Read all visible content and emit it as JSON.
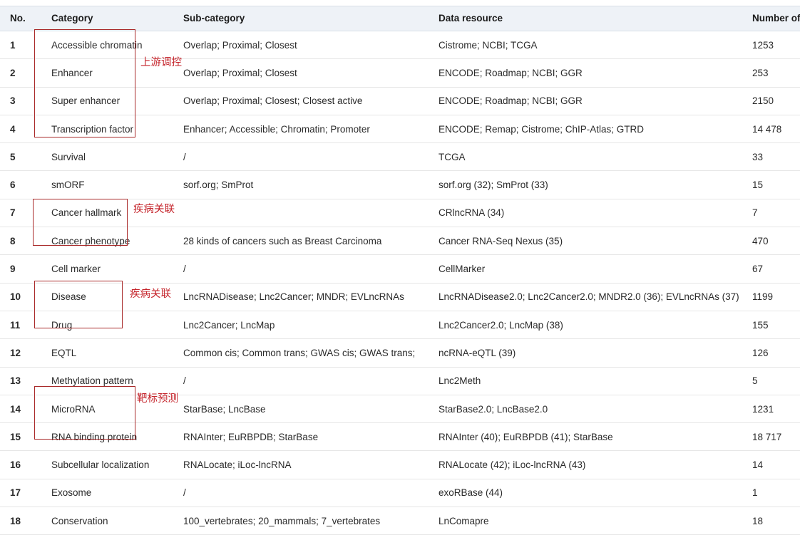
{
  "table": {
    "columns": [
      {
        "key": "no",
        "label": "No."
      },
      {
        "key": "cat",
        "label": "Category"
      },
      {
        "key": "sub",
        "label": "Sub-category"
      },
      {
        "key": "res",
        "label": "Data resource"
      },
      {
        "key": "num",
        "label": "Number of sets"
      }
    ],
    "rows": [
      {
        "no": "1",
        "cat": "Accessible chromatin",
        "sub": "Overlap; Proximal; Closest",
        "res": "Cistrome; NCBI; TCGA",
        "num": "1253"
      },
      {
        "no": "2",
        "cat": "Enhancer",
        "sub": "Overlap; Proximal; Closest",
        "res": "ENCODE; Roadmap; NCBI; GGR",
        "num": "253"
      },
      {
        "no": "3",
        "cat": "Super enhancer",
        "sub": "Overlap; Proximal; Closest; Closest active",
        "res": "ENCODE; Roadmap; NCBI; GGR",
        "num": "2150"
      },
      {
        "no": "4",
        "cat": "Transcription factor",
        "sub": "Enhancer; Accessible; Chromatin; Promoter",
        "res": "ENCODE; Remap; Cistrome; ChIP-Atlas; GTRD",
        "num": "14 478"
      },
      {
        "no": "5",
        "cat": "Survival",
        "sub": "/",
        "res": "TCGA",
        "num": "33"
      },
      {
        "no": "6",
        "cat": "smORF",
        "sub": "sorf.org; SmProt",
        "res": "sorf.org (32); SmProt (33)",
        "num": "15"
      },
      {
        "no": "7",
        "cat": "Cancer hallmark",
        "sub": "",
        "res": "CRlncRNA (34)",
        "num": "7"
      },
      {
        "no": "8",
        "cat": "Cancer phenotype",
        "sub": "28 kinds of cancers such as Breast Carcinoma",
        "res": "Cancer RNA-Seq Nexus (35)",
        "num": "470"
      },
      {
        "no": "9",
        "cat": "Cell marker",
        "sub": "/",
        "res": "CellMarker",
        "num": "67"
      },
      {
        "no": "10",
        "cat": "Disease",
        "sub": "LncRNADisease; Lnc2Cancer; MNDR; EVLncRNAs",
        "res": "LncRNADisease2.0; Lnc2Cancer2.0; MNDR2.0 (36); EVLncRNAs (37)",
        "num": "1199"
      },
      {
        "no": "11",
        "cat": "Drug",
        "sub": "Lnc2Cancer; LncMap",
        "res": "Lnc2Cancer2.0; LncMap (38)",
        "num": "155"
      },
      {
        "no": "12",
        "cat": "EQTL",
        "sub": "Common cis; Common trans; GWAS cis; GWAS trans;",
        "res": "ncRNA-eQTL (39)",
        "num": "126"
      },
      {
        "no": "13",
        "cat": "Methylation pattern",
        "sub": "/",
        "res": "Lnc2Meth",
        "num": "5"
      },
      {
        "no": "14",
        "cat": "MicroRNA",
        "sub": "StarBase; LncBase",
        "res": "StarBase2.0; LncBase2.0",
        "num": "1231"
      },
      {
        "no": "15",
        "cat": "RNA binding protein",
        "sub": "RNAInter; EuRBPDB; StarBase",
        "res": "RNAInter (40); EuRBPDB (41); StarBase",
        "num": "18 717"
      },
      {
        "no": "16",
        "cat": "Subcellular localization",
        "sub": "RNALocate; iLoc-lncRNA",
        "res": "RNALocate (42); iLoc-lncRNA (43)",
        "num": "14"
      },
      {
        "no": "17",
        "cat": "Exosome",
        "sub": "/",
        "res": "exoRBase (44)",
        "num": "1"
      },
      {
        "no": "18",
        "cat": "Conservation",
        "sub": "100_vertebrates; 20_mammals; 7_vertebrates",
        "res": "LnComapre",
        "num": "18"
      }
    ]
  },
  "annotations": {
    "color": "#c5242b",
    "box_color": "#a92a2a",
    "labels": [
      {
        "id": "upstream-regulation",
        "text": "上游调控"
      },
      {
        "id": "disease-association-1",
        "text": "疾病关联"
      },
      {
        "id": "disease-association-2",
        "text": "疾病关联"
      },
      {
        "id": "target-prediction",
        "text": "靶标预测"
      }
    ]
  }
}
